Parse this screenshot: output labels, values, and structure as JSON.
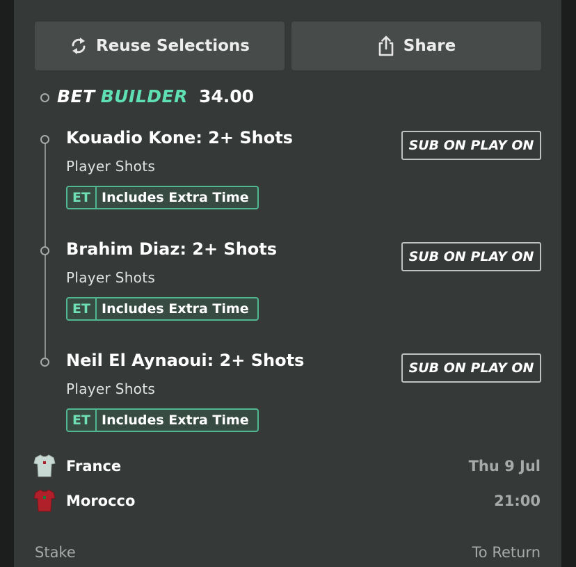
{
  "actions": {
    "reuse_label": "Reuse Selections",
    "share_label": "Share"
  },
  "bet_builder": {
    "label_bet": "BET",
    "label_builder": "BUILDER",
    "odds": "34.00",
    "accent_color": "#5fe0b3"
  },
  "legs": [
    {
      "title": "Kouadio Kone: 2+ Shots",
      "market": "Player Shots",
      "badge_code": "ET",
      "badge_text": "Includes Extra Time",
      "sub_label": "SUB ON PLAY ON"
    },
    {
      "title": "Brahim Diaz: 2+ Shots",
      "market": "Player Shots",
      "badge_code": "ET",
      "badge_text": "Includes Extra Time",
      "sub_label": "SUB ON PLAY ON"
    },
    {
      "title": "Neil El Aynaoui: 2+ Shots",
      "market": "Player Shots",
      "badge_code": "ET",
      "badge_text": "Includes Extra Time",
      "sub_label": "SUB ON PLAY ON"
    }
  ],
  "match": {
    "home": {
      "name": "France",
      "shirt_icon": "shirt-icon",
      "shirt_color": "#c8d8d2"
    },
    "away": {
      "name": "Morocco",
      "shirt_icon": "shirt-icon",
      "shirt_color": "#b0202a"
    },
    "date": "Thu 9 Jul",
    "time": "21:00"
  },
  "footer": {
    "stake_label": "Stake",
    "return_label": "To Return"
  }
}
